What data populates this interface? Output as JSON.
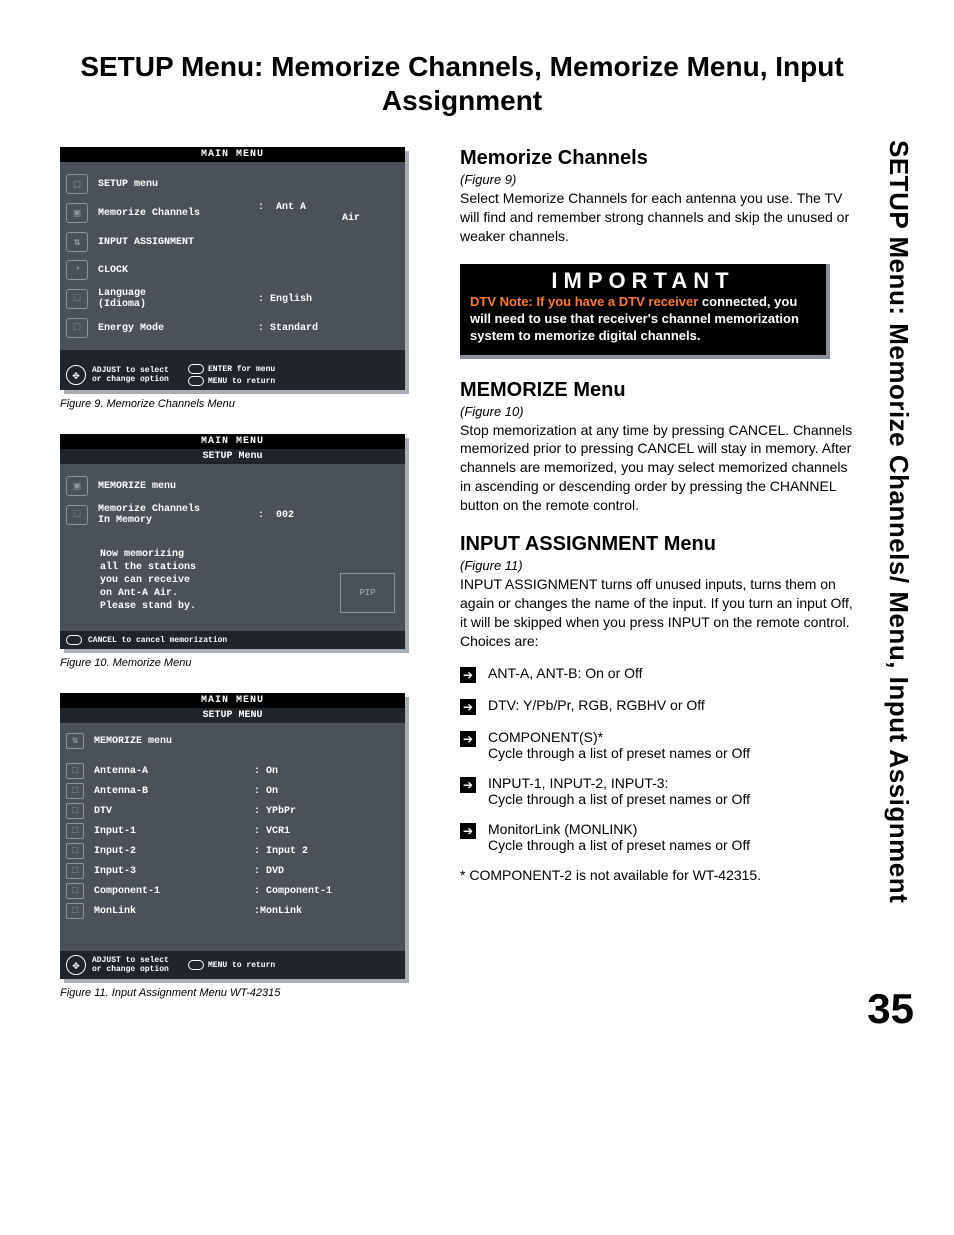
{
  "page_title": "SETUP Menu: Memorize Channels, Memorize Menu, Input Assignment",
  "sidebar_title": "SETUP Menu: Memorize Channels/ Menu, Input Assignment",
  "page_number": "35",
  "fig9": {
    "header": "MAIN MENU",
    "rows": [
      {
        "label": "SETUP menu",
        "val": ""
      },
      {
        "label": "Memorize Channels",
        "val": ":  Ant A\n              Air"
      },
      {
        "label": "INPUT ASSIGNMENT",
        "val": ""
      },
      {
        "label": "CLOCK",
        "val": ""
      },
      {
        "label": "Language\n(Idioma)",
        "val": ": English"
      },
      {
        "label": "Energy Mode",
        "val": ": Standard"
      }
    ],
    "footer_left": "ADJUST to select\nor change option",
    "footer_enter": "ENTER for menu",
    "footer_menu": "MENU  to return",
    "caption": "Figure 9.  Memorize Channels Menu"
  },
  "fig10": {
    "header": "MAIN MENU",
    "subheader": "SETUP Menu",
    "rows": [
      {
        "label": "MEMORIZE menu",
        "val": ""
      },
      {
        "label": "Memorize Channels\nIn Memory",
        "val": ":  002"
      }
    ],
    "message": "Now memorizing\nall the stations\nyou can receive\non Ant-A Air.\nPlease stand by.",
    "pip": "PIP",
    "footer": "CANCEL to cancel memorization",
    "caption": "Figure 10.  Memorize Menu"
  },
  "fig11": {
    "header": "MAIN MENU",
    "subheader": "SETUP MENU",
    "rows": [
      {
        "label": "MEMORIZE menu",
        "val": ""
      },
      {
        "label": "Antenna-A",
        "val": ": On"
      },
      {
        "label": "Antenna-B",
        "val": ": On"
      },
      {
        "label": "DTV",
        "val": ": YPbPr"
      },
      {
        "label": "Input-1",
        "val": ": VCR1"
      },
      {
        "label": "Input-2",
        "val": ": Input 2"
      },
      {
        "label": "Input-3",
        "val": ": DVD"
      },
      {
        "label": "Component-1",
        "val": ": Component-1"
      },
      {
        "label": "MonLink",
        "val": ":MonLink"
      }
    ],
    "footer_left": "ADJUST to select\nor change option",
    "footer_menu": "MENU  to return",
    "caption": "Figure 11.  Input Assignment Menu WT-42315"
  },
  "sections": {
    "memorize_channels": {
      "title": "Memorize Channels",
      "figref": "(Figure 9)",
      "text": "Select Memorize Channels for each antenna you use.  The TV will find and remember strong channels and skip the unused or weaker channels."
    },
    "important": {
      "title": "IMPORTANT",
      "dtv_prefix": "DTV Note: If you have a DTV receiver",
      "rest": "connected, you will need to use that receiver's channel memorization system to memorize digital channels."
    },
    "memorize_menu": {
      "title": "MEMORIZE Menu",
      "figref": "(Figure 10)",
      "text": "Stop memorization at any time by pressing CANCEL.  Channels memorized prior to pressing CANCEL will stay in memory.  After channels are memorized, you may select memorized channels in ascending or descending order by pressing the CHANNEL button on the remote control."
    },
    "input_assignment": {
      "title": "INPUT ASSIGNMENT Menu",
      "figref": "(Figure 11)",
      "text": "INPUT ASSIGNMENT turns off unused inputs, turns them on again or changes the name of the input.  If you turn an input Off, it will be skipped when you press INPUT on the remote control.  Choices are:"
    },
    "bullets": [
      "ANT-A, ANT-B: On or Off",
      "DTV: Y/Pb/Pr, RGB, RGBHV or Off",
      "COMPONENT(S)*\nCycle through a list of preset names or Off",
      "INPUT-1, INPUT-2, INPUT-3:\nCycle through a list of preset names or Off",
      "MonitorLink (MONLINK)\nCycle through a list of preset names or Off"
    ],
    "footnote": "* COMPONENT-2 is not available for WT-42315."
  }
}
